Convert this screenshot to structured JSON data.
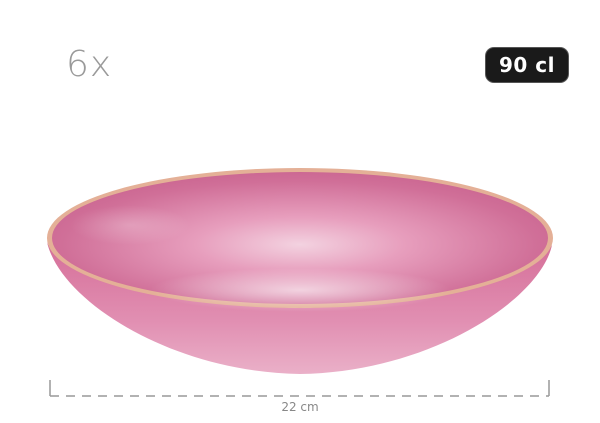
{
  "quantity_label": "6x",
  "volume_badge": "90 cl",
  "dimension_label": "22 cm",
  "colors": {
    "bowl_glaze": "#d7789f",
    "bowl_rim": "#e0a98d",
    "badge_bg": "#1a1a1a",
    "text_gray": "#9a9a9a"
  }
}
